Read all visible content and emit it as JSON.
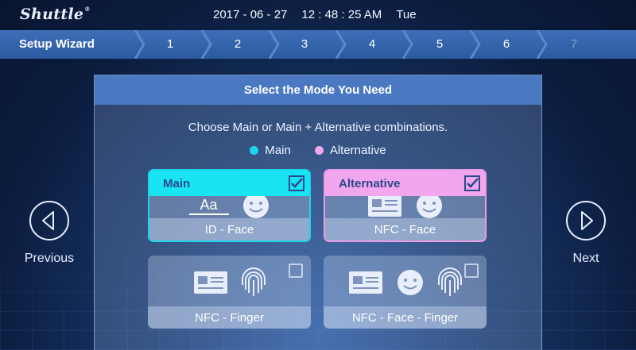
{
  "brand": "Shuttle",
  "datetime": {
    "date": "2017 - 06 - 27",
    "time": "12 : 48 : 25 AM",
    "day": "Tue"
  },
  "wizard": {
    "title": "Setup Wizard",
    "steps": [
      "1",
      "2",
      "3",
      "4",
      "5",
      "6",
      "7"
    ],
    "current_step": 6
  },
  "panel": {
    "title": "Select the Mode You Need",
    "instruction": "Choose Main or Main + Alternative combinations.",
    "legend": [
      {
        "label": "Main",
        "color": "#1ad6e8"
      },
      {
        "label": "Alternative",
        "color": "#f2a6ee"
      }
    ],
    "cards": [
      {
        "caption": "ID - Face",
        "selected_as": "Main",
        "icons": [
          "id-text-icon",
          "face-icon"
        ]
      },
      {
        "caption": "NFC - Face",
        "selected_as": "Alternative",
        "icons": [
          "nfc-card-icon",
          "face-icon"
        ]
      },
      {
        "caption": "NFC - Finger",
        "selected_as": "",
        "icons": [
          "nfc-card-icon",
          "fingerprint-icon"
        ]
      },
      {
        "caption": "NFC - Face - Finger",
        "selected_as": "",
        "icons": [
          "nfc-card-icon",
          "face-icon",
          "fingerprint-icon"
        ]
      }
    ]
  },
  "nav": {
    "previous": "Previous",
    "next": "Next"
  },
  "icon_text": {
    "id_glyph": "Aa"
  }
}
